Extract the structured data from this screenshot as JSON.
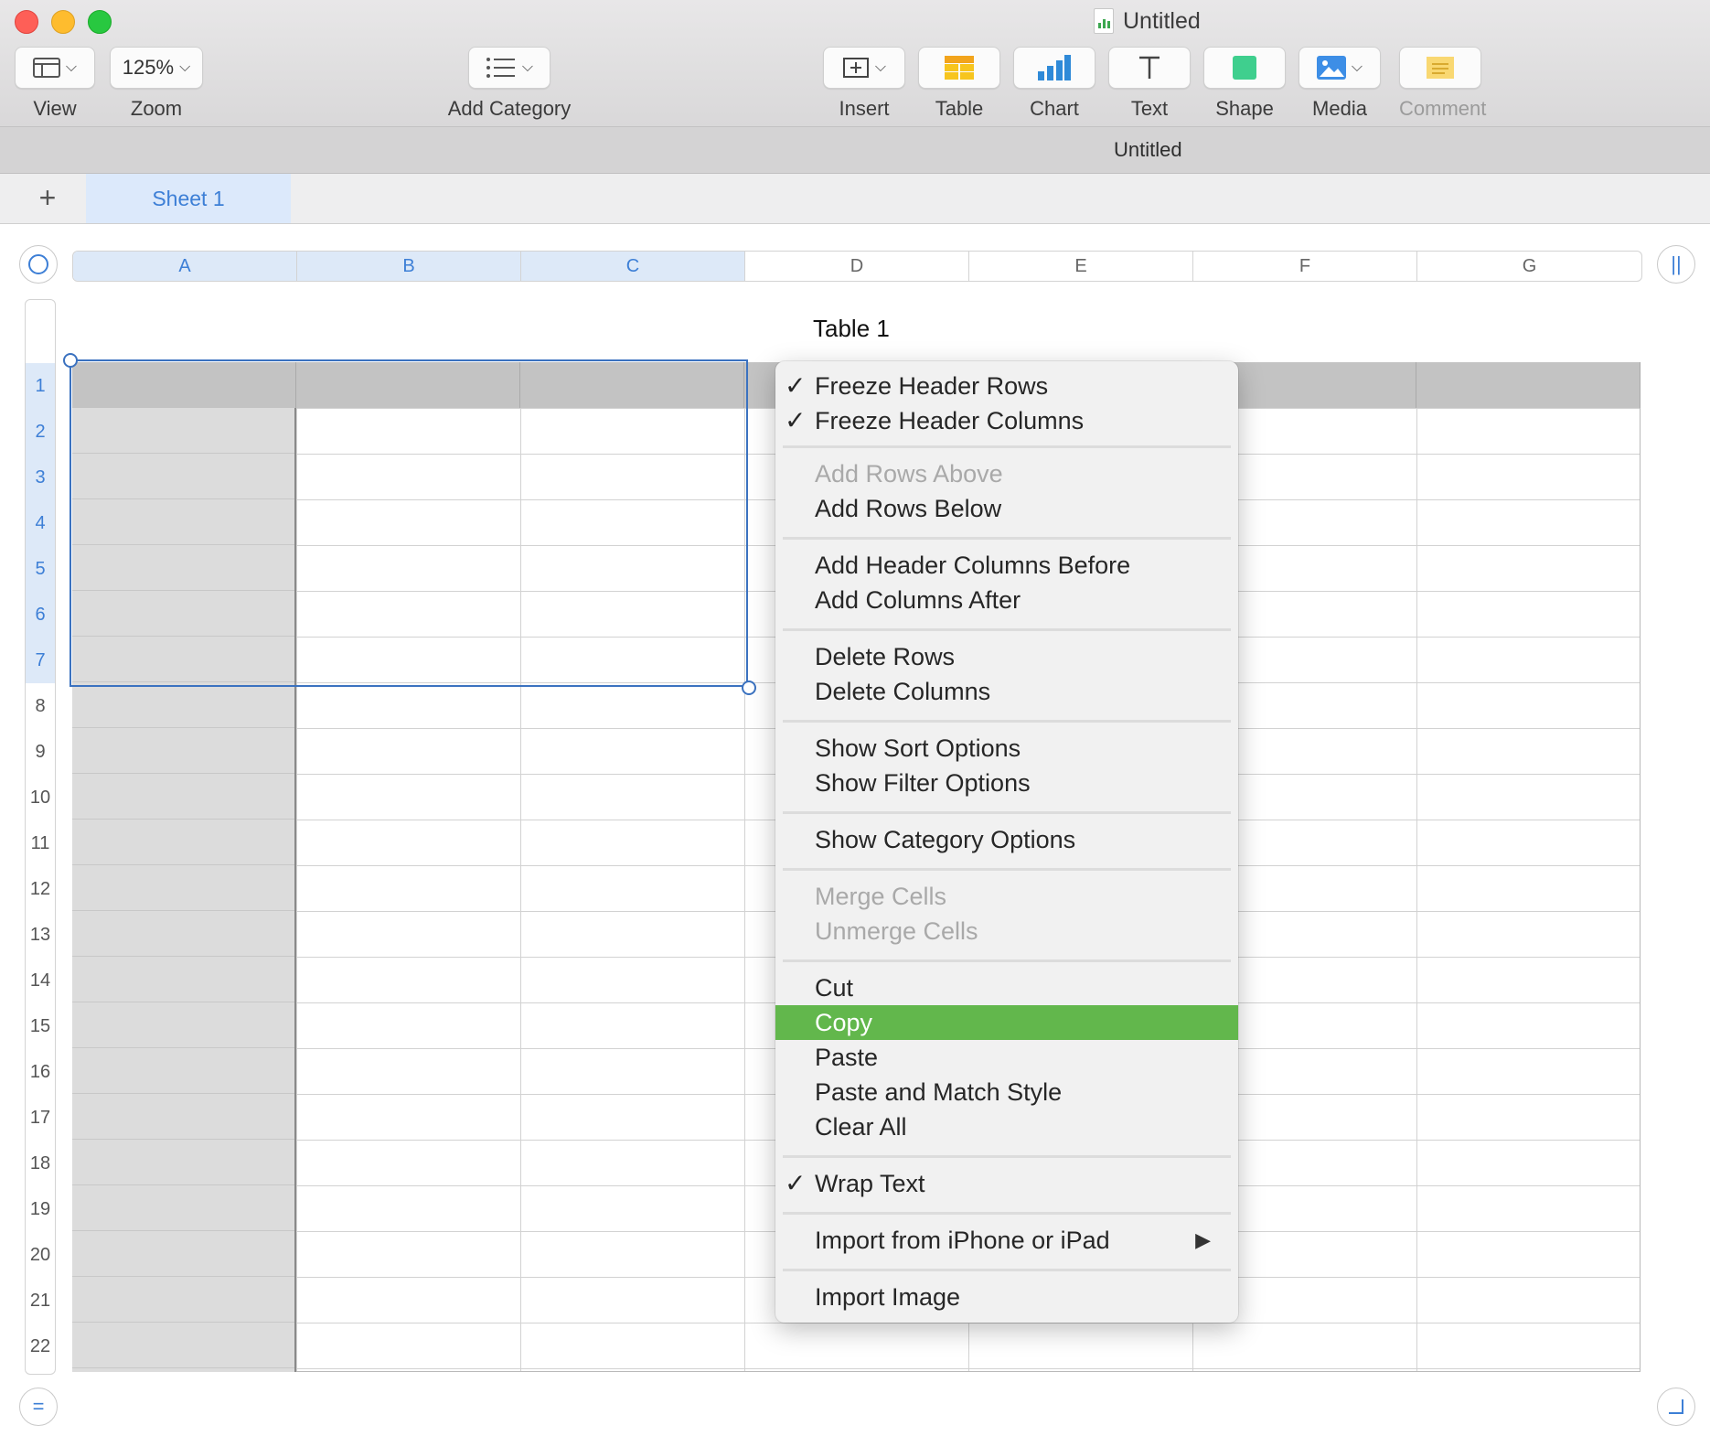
{
  "window": {
    "title": "Untitled"
  },
  "toolbar": {
    "view_label": "View",
    "zoom_label": "Zoom",
    "zoom_value": "125%",
    "add_category_label": "Add Category",
    "insert_label": "Insert",
    "table_label": "Table",
    "chart_label": "Chart",
    "text_label": "Text",
    "shape_label": "Shape",
    "media_label": "Media",
    "comment_label": "Comment"
  },
  "document": {
    "title": "Untitled"
  },
  "sheets": {
    "add_symbol": "+",
    "tabs": [
      "Sheet 1"
    ]
  },
  "table": {
    "title": "Table 1",
    "columns": [
      "A",
      "B",
      "C",
      "D",
      "E",
      "F",
      "G"
    ],
    "rows": [
      "1",
      "2",
      "3",
      "4",
      "5",
      "6",
      "7",
      "8",
      "9",
      "10",
      "11",
      "12",
      "13",
      "14",
      "15",
      "16",
      "17",
      "18",
      "19",
      "20",
      "21",
      "22"
    ]
  },
  "context_menu": {
    "freeze_header_rows": "Freeze Header Rows",
    "freeze_header_columns": "Freeze Header Columns",
    "add_rows_above": "Add Rows Above",
    "add_rows_below": "Add Rows Below",
    "add_header_columns_before": "Add Header Columns Before",
    "add_columns_after": "Add Columns After",
    "delete_rows": "Delete Rows",
    "delete_columns": "Delete Columns",
    "show_sort_options": "Show Sort Options",
    "show_filter_options": "Show Filter Options",
    "show_category_options": "Show Category Options",
    "merge_cells": "Merge Cells",
    "unmerge_cells": "Unmerge Cells",
    "cut": "Cut",
    "copy": "Copy",
    "paste": "Paste",
    "paste_and_match_style": "Paste and Match Style",
    "clear_all": "Clear All",
    "wrap_text": "Wrap Text",
    "import_from_iphone": "Import from iPhone or iPad",
    "import_image": "Import Image",
    "check_glyph": "✓",
    "submenu_glyph": "▶"
  },
  "colors": {
    "accent": "#3d7fd6",
    "highlight": "#62b74c",
    "close": "#fe5f57",
    "minimize": "#febc2e",
    "maximize": "#28c840"
  }
}
